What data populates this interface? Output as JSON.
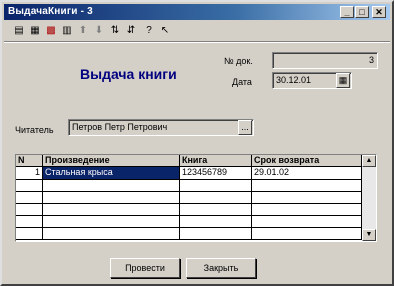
{
  "window": {
    "title": "ВыдачаКниги - 3"
  },
  "title_buttons": {
    "minimize": "_",
    "maximize": "□",
    "close": "✕"
  },
  "toolbar": {
    "icons": [
      "new-doc-icon",
      "print-icon",
      "delete-icon",
      "copy-icon",
      "up-arrow-icon",
      "down-arrow-icon",
      "sort-asc-icon",
      "sort-desc-icon",
      "help-icon",
      "context-help-icon"
    ]
  },
  "form": {
    "heading": "Выдача книги",
    "doc_no_label": "№ док.",
    "doc_no_value": "3",
    "date_label": "Дата",
    "date_value": "30.12.01",
    "reader_label": "Читатель",
    "reader_value": "Петров Петр Петрович",
    "ellipsis": "..."
  },
  "table": {
    "columns": [
      "N",
      "Произведение",
      "Книга",
      "Срок возврата"
    ],
    "rows": [
      {
        "n": "1",
        "work": "Стальная крыса",
        "book": "123456789",
        "due": "29.01.02"
      }
    ]
  },
  "buttons": {
    "post": "Провести",
    "close": "Закрыть"
  }
}
